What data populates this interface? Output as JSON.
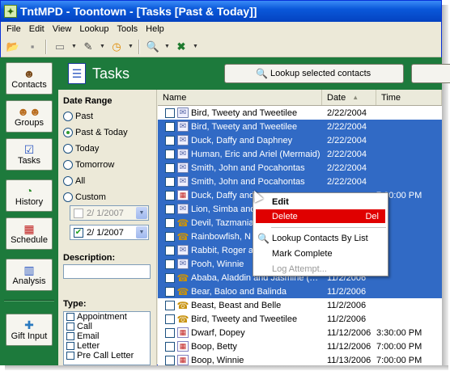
{
  "window": {
    "title": "TntMPD - Toontown - [Tasks [Past & Today]]"
  },
  "menubar": [
    "File",
    "Edit",
    "View",
    "Lookup",
    "Tools",
    "Help"
  ],
  "nav": [
    {
      "label": "Contacts",
      "icon": "contacts-icon"
    },
    {
      "label": "Groups",
      "icon": "groups-icon"
    },
    {
      "label": "Tasks",
      "icon": "tasks-icon"
    },
    {
      "label": "History",
      "icon": "history-icon"
    },
    {
      "label": "Schedule",
      "icon": "schedule-icon"
    },
    {
      "label": "Analysis",
      "icon": "analysis-icon"
    },
    {
      "label": "Gift Input",
      "icon": "gift-icon"
    }
  ],
  "header": {
    "title": "Tasks",
    "lookup_button": "Lookup selected contacts"
  },
  "filter": {
    "date_range_label": "Date Range",
    "options": [
      "Past",
      "Past & Today",
      "Today",
      "Tomorrow",
      "All",
      "Custom"
    ],
    "selected": "Past & Today",
    "date_from": "2/ 1/2007",
    "date_to": "2/ 1/2007",
    "description_label": "Description:",
    "description_value": "",
    "type_label": "Type:",
    "types": [
      "Appointment",
      "Call",
      "Email",
      "Letter",
      "Pre Call Letter"
    ]
  },
  "grid": {
    "columns": [
      "Name",
      "Date",
      "Time"
    ],
    "sort_column": "Date",
    "rows": [
      {
        "name": "Bird, Tweety and Tweetilee",
        "date": "2/22/2004",
        "time": "",
        "type": "email",
        "selected": false
      },
      {
        "name": "Bird, Tweety and Tweetilee",
        "date": "2/22/2004",
        "time": "",
        "type": "email",
        "selected": true
      },
      {
        "name": "Duck, Daffy and Daphney",
        "date": "2/22/2004",
        "time": "",
        "type": "email",
        "selected": true
      },
      {
        "name": "Human, Eric and Ariel (Mermaid)",
        "date": "2/22/2004",
        "time": "",
        "type": "email",
        "selected": true
      },
      {
        "name": "Smith, John and Pocahontas",
        "date": "2/22/2004",
        "time": "",
        "type": "email",
        "selected": true
      },
      {
        "name": "Smith, John and Pocahontas",
        "date": "2/22/2004",
        "time": "",
        "type": "email",
        "selected": true
      },
      {
        "name": "Duck, Daffy and",
        "date": "",
        "time": "7:00:00 PM",
        "type": "schedule",
        "selected": true
      },
      {
        "name": "Lion, Simba and",
        "date": "",
        "time": "",
        "type": "email",
        "selected": true
      },
      {
        "name": "Devil, Tazmania",
        "date": "",
        "time": "",
        "type": "call",
        "selected": true
      },
      {
        "name": "Rainbowfish, N",
        "date": "",
        "time": "",
        "type": "call",
        "selected": true
      },
      {
        "name": "Rabbit, Roger a",
        "date": "",
        "time": "",
        "type": "email",
        "selected": true
      },
      {
        "name": "Pooh, Winnie",
        "date": "",
        "time": "",
        "type": "email",
        "selected": true
      },
      {
        "name": "Ababa, Aladdin and Jasmine (…",
        "date": "11/2/2006",
        "time": "",
        "type": "call",
        "selected": true
      },
      {
        "name": "Bear, Baloo and Balinda",
        "date": "11/2/2006",
        "time": "",
        "type": "call",
        "selected": true
      },
      {
        "name": "Beast, Beast and Belle",
        "date": "11/2/2006",
        "time": "",
        "type": "call",
        "selected": false
      },
      {
        "name": "Bird, Tweety and Tweetilee",
        "date": "11/2/2006",
        "time": "",
        "type": "call",
        "selected": false
      },
      {
        "name": "Dwarf, Dopey",
        "date": "11/12/2006",
        "time": "3:30:00 PM",
        "type": "schedule",
        "selected": false
      },
      {
        "name": "Boop, Betty",
        "date": "11/12/2006",
        "time": "7:00:00 PM",
        "type": "schedule",
        "selected": false
      },
      {
        "name": "Boop, Winnie",
        "date": "11/13/2006",
        "time": "7:00:00 PM",
        "type": "schedule",
        "selected": false
      }
    ]
  },
  "context_menu": {
    "edit": "Edit",
    "delete": "Delete",
    "delete_shortcut": "Del",
    "lookup": "Lookup Contacts By List",
    "mark_complete": "Mark Complete",
    "log_attempt": "Log Attempt..."
  }
}
